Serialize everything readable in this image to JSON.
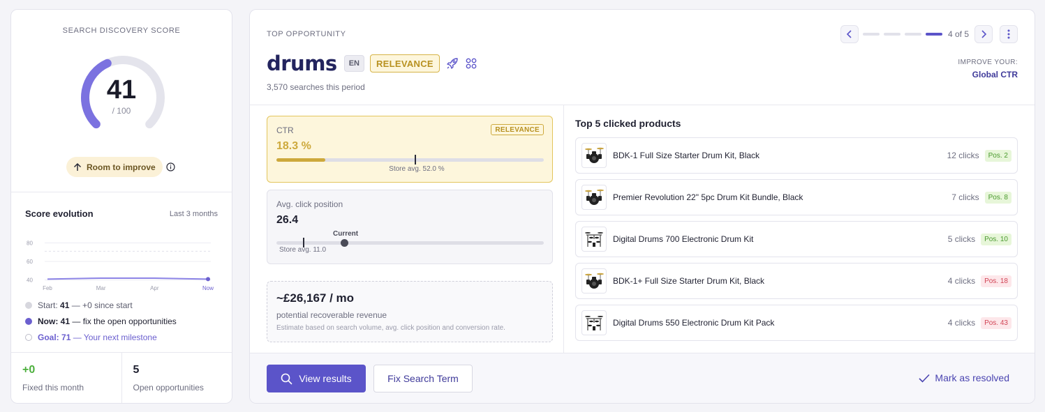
{
  "score": {
    "title": "SEARCH DISCOVERY SCORE",
    "value": "41",
    "max_label": "/ 100",
    "fraction": 0.41,
    "status_label": "Room to improve",
    "accent": "#7b72e0"
  },
  "evolution": {
    "title": "Score evolution",
    "range": "Last 3 months",
    "legend": [
      {
        "label": "Start:",
        "value": "41",
        "note": " — +0 since start",
        "color": "#d7d7de"
      },
      {
        "label": "Now:",
        "value": "41",
        "note": " — fix the open opportunities",
        "color": "#6b5fcf"
      },
      {
        "label": "Goal:",
        "value": "71",
        "note": " — Your next milestone",
        "color": "#ffffff"
      }
    ]
  },
  "chart_data": {
    "type": "line",
    "categories": [
      "Feb",
      "Mar",
      "Apr",
      "Now"
    ],
    "y_ticks": [
      "80",
      "60",
      "40"
    ],
    "ylim": [
      30,
      90
    ],
    "series": [
      {
        "values": [
          41,
          42,
          42,
          41
        ]
      }
    ],
    "goal": 71,
    "grid": true
  },
  "stats": [
    {
      "value": "+0",
      "label": "Fixed this month"
    },
    {
      "value": "5",
      "label": "Open opportunities"
    }
  ],
  "opportunity": {
    "label": "TOP OPPORTUNITY",
    "term": "drums",
    "lang": "EN",
    "category": "RELEVANCE",
    "searches": "3,570 searches this period",
    "pager": {
      "text": "4 of 5",
      "current": 4,
      "total": 5
    },
    "improve_label": "IMPROVE YOUR:",
    "improve_value": "Global CTR"
  },
  "metrics": {
    "ctr": {
      "label": "CTR",
      "value": "18.3 %",
      "tag": "RELEVANCE",
      "fraction": 0.183,
      "store_avg_fraction": 0.52,
      "store_avg_label": "Store avg. 52.0 %"
    },
    "position": {
      "label": "Avg. click position",
      "value": "26.4",
      "current_label": "Current",
      "store_avg_label": "Store avg. 11.0"
    },
    "revenue": {
      "value": "~£26,167 / mo",
      "label": "potential recoverable revenue",
      "note": "Estimate based on search volume, avg. click position and conversion rate."
    }
  },
  "products": {
    "title": "Top 5 clicked products",
    "items": [
      {
        "name": "BDK-1 Full Size Starter Drum Kit, Black",
        "clicks": "12 clicks",
        "pos": "Pos. 2",
        "status": "ok",
        "icon": "acoustic-drum-kit-icon"
      },
      {
        "name": "Premier Revolution 22\" 5pc Drum Kit Bundle, Black",
        "clicks": "7 clicks",
        "pos": "Pos. 8",
        "status": "ok",
        "icon": "acoustic-drum-kit-icon"
      },
      {
        "name": "Digital Drums 700 Electronic Drum Kit",
        "clicks": "5 clicks",
        "pos": "Pos. 10",
        "status": "ok",
        "icon": "electronic-drum-kit-icon"
      },
      {
        "name": "BDK-1+ Full Size Starter Drum Kit, Black",
        "clicks": "4 clicks",
        "pos": "Pos. 18",
        "status": "bad",
        "icon": "acoustic-drum-kit-icon"
      },
      {
        "name": "Digital Drums 550 Electronic Drum Kit Pack",
        "clicks": "4 clicks",
        "pos": "Pos. 43",
        "status": "bad",
        "icon": "electronic-drum-kit-icon"
      }
    ]
  },
  "footer": {
    "view_results": "View results",
    "fix_term": "Fix Search Term",
    "resolve": "Mark as resolved"
  }
}
